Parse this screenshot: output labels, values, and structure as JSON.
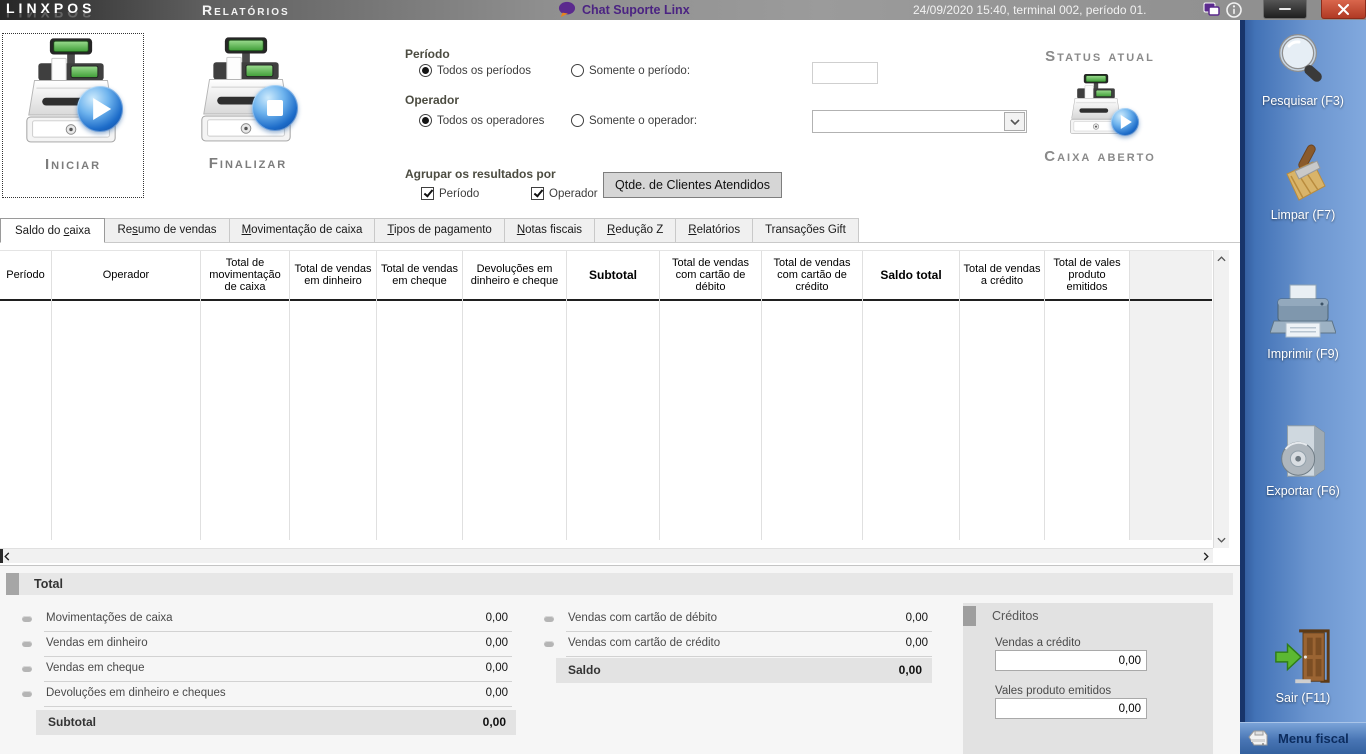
{
  "titlebar": {
    "logo": "LINXPOS",
    "title": "Relatórios",
    "chat_label": "Chat Suporte Linx",
    "session_info": "24/09/2020 15:40, terminal 002, período 01."
  },
  "actions": {
    "start_label": "Iniciar",
    "finish_label": "Finalizar"
  },
  "filters": {
    "period_label": "Período",
    "period_all": "Todos os períodos",
    "period_only": "Somente o período:",
    "period_value": "",
    "operator_label": "Operador",
    "operator_all": "Todos os operadores",
    "operator_only": "Somente o operador:",
    "operator_value": "",
    "group_label": "Agrupar os resultados por",
    "group_period": "Período",
    "group_operator": "Operador",
    "clients_button_label": "Qtde. de Clientes Atendidos"
  },
  "status": {
    "title": "Status atual",
    "value": "Caixa aberto"
  },
  "tabs": [
    {
      "pre": "Saldo do ",
      "key": "c",
      "post": "aixa",
      "active": true
    },
    {
      "pre": "Re",
      "key": "s",
      "post": "umo de vendas",
      "active": false
    },
    {
      "pre": "",
      "key": "M",
      "post": "ovimentação de caixa",
      "active": false
    },
    {
      "pre": "",
      "key": "T",
      "post": "ipos de pagamento",
      "active": false
    },
    {
      "pre": "",
      "key": "N",
      "post": "otas fiscais",
      "active": false
    },
    {
      "pre": "",
      "key": "R",
      "post": "edução Z",
      "active": false
    },
    {
      "pre": "",
      "key": "R",
      "post": "elatórios",
      "active": false
    },
    {
      "pre": "Transações Gift",
      "key": "",
      "post": "",
      "active": false
    }
  ],
  "table": {
    "columns": [
      "Período",
      "Operador",
      "Total de movimentação de caixa",
      "Total de vendas em dinheiro",
      "Total de vendas em cheque",
      "Devoluções em dinheiro e cheque",
      "Subtotal",
      "Total de vendas com cartão de débito",
      "Total de vendas com cartão de crédito",
      "Saldo total",
      "Total de vendas a crédito",
      "Total de vales produto emitidos"
    ],
    "rows": []
  },
  "totals": {
    "title": "Total",
    "left_rows": [
      {
        "label": "Movimentações de caixa",
        "value": "0,00"
      },
      {
        "label": "Vendas em dinheiro",
        "value": "0,00"
      },
      {
        "label": "Vendas em cheque",
        "value": "0,00"
      },
      {
        "label": "Devoluções em dinheiro e cheques",
        "value": "0,00"
      }
    ],
    "subtotal": {
      "label": "Subtotal",
      "value": "0,00"
    },
    "mid_rows": [
      {
        "label": "Vendas com cartão de débito",
        "value": "0,00"
      },
      {
        "label": "Vendas com cartão de crédito",
        "value": "0,00"
      }
    ],
    "saldo": {
      "label": "Saldo",
      "value": "0,00"
    }
  },
  "credits": {
    "title": "Créditos",
    "fields": [
      {
        "label": "Vendas a crédito",
        "value": "0,00"
      },
      {
        "label": "Vales produto emitidos",
        "value": "0,00"
      }
    ]
  },
  "sidebar": {
    "buttons": [
      {
        "label": "Pesquisar (F3)",
        "icon": "search-icon"
      },
      {
        "label": "Limpar (F7)",
        "icon": "broom-icon"
      },
      {
        "label": "Imprimir (F9)",
        "icon": "printer-icon"
      },
      {
        "label": "Exportar (F6)",
        "icon": "export-disc-icon"
      },
      {
        "label": "Sair (F11)",
        "icon": "exit-door-icon"
      }
    ],
    "menu_fiscal_label": "Menu fiscal"
  },
  "colors": {
    "brand_purple": "#4b2382",
    "sidebar_blue": "#4272b6",
    "close_red": "#b03a24",
    "status_gray": "#8a8a8a"
  }
}
